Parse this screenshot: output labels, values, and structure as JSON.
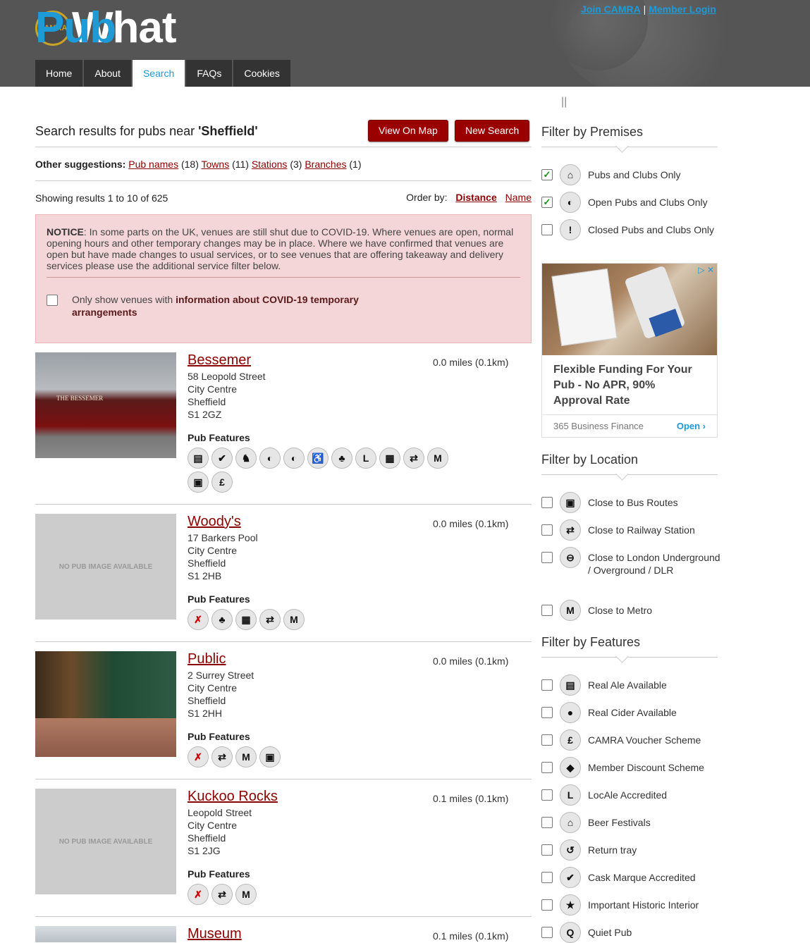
{
  "header": {
    "logo_seal": "CAMRA",
    "logo_what": "What",
    "logo_pub": "Pub",
    "join": "Join CAMRA",
    "sep": "|",
    "login": "Member Login"
  },
  "nav": [
    {
      "label": "Home"
    },
    {
      "label": "About"
    },
    {
      "label": "Search"
    },
    {
      "label": "FAQs"
    },
    {
      "label": "Cookies"
    }
  ],
  "pipes": "||",
  "search": {
    "prefix": "Search results for pubs near ",
    "term": "'Sheffield'",
    "view_map": "View On Map",
    "new_search": "New Search"
  },
  "suggestions": {
    "label": "Other suggestions:",
    "items": [
      {
        "link": "Pub names",
        "count": "(18)"
      },
      {
        "link": "Towns",
        "count": "(11)"
      },
      {
        "link": "Stations",
        "count": "(3)"
      },
      {
        "link": "Branches",
        "count": "(1)"
      }
    ]
  },
  "results": {
    "showing": "Showing results 1 to 10 of 625",
    "order_label": "Order by:",
    "order_distance": "Distance",
    "order_name": "Name"
  },
  "notice": {
    "label": "NOTICE",
    "text": ": In some parts on the UK, venues are still shut due to COVID-19. Where venues are open, normal opening hours and other temporary changes may be in place. Where we have confirmed that venues are open but have made changes to usual services, or to see venues that are offering takeaway and delivery services please use the additional service filter below.",
    "check_prefix": "Only show venues with ",
    "check_bold": "information about COVID-19 temporary arrangements"
  },
  "features_label": "Pub Features",
  "no_image": "NO PUB IMAGE AVAILABLE",
  "pubs": [
    {
      "name": "Bessemer",
      "street": "58 Leopold Street",
      "area": "City Centre",
      "town": "Sheffield",
      "postcode": "S1 2GZ",
      "distance": "0.0 miles (0.1km)",
      "photo_sign": "THE BESSEMER"
    },
    {
      "name": "Woody's",
      "street": "17 Barkers Pool",
      "area": "City Centre",
      "town": "Sheffield",
      "postcode": "S1 2HB",
      "distance": "0.0 miles (0.1km)"
    },
    {
      "name": "Public",
      "street": "2 Surrey Street",
      "area": "City Centre",
      "town": "Sheffield",
      "postcode": "S1 2HH",
      "distance": "0.0 miles (0.1km)"
    },
    {
      "name": "Kuckoo Rocks",
      "street": "Leopold Street",
      "area": "City Centre",
      "town": "Sheffield",
      "postcode": "S1 2JG",
      "distance": "0.1 miles (0.1km)"
    },
    {
      "name": "Museum",
      "distance": "0.1 miles (0.1km)"
    }
  ],
  "icons": {
    "cask": "▤",
    "tick": "✔",
    "horse": "♞",
    "half": "◐",
    "wheelchair": "♿",
    "club": "♣",
    "L": "L",
    "calendar": "▦",
    "rail": "⇄",
    "M": "M",
    "bus": "▣",
    "pound": "£",
    "nope": "✗",
    "tube": "⊖",
    "apple": "●",
    "tag": "◆",
    "tent": "⌂",
    "return": "↺",
    "star": "★",
    "Q": "Q",
    "building": "⌂",
    "excl": "!"
  },
  "sidebar": {
    "premises_title": "Filter by Premises",
    "premises": [
      {
        "label": "Pubs and Clubs Only",
        "check": "✓"
      },
      {
        "label": "Open Pubs and Clubs Only",
        "check": "✓"
      },
      {
        "label": "Closed Pubs and Clubs Only",
        "check": ""
      }
    ],
    "location_title": "Filter by Location",
    "location": [
      {
        "label": "Close to Bus Routes"
      },
      {
        "label": "Close to Railway Station"
      },
      {
        "label": "Close to London Underground / Overground / DLR"
      },
      {
        "label": "Close to Metro"
      }
    ],
    "features_title": "Filter by Features",
    "features": [
      {
        "label": "Real Ale Available"
      },
      {
        "label": "Real Cider Available"
      },
      {
        "label": "CAMRA Voucher Scheme"
      },
      {
        "label": "Member Discount Scheme"
      },
      {
        "label": "LocAle Accredited"
      },
      {
        "label": "Beer Festivals"
      },
      {
        "label": "Return tray"
      },
      {
        "label": "Cask Marque Accredited"
      },
      {
        "label": "Important Historic Interior"
      },
      {
        "label": "Quiet Pub"
      }
    ]
  },
  "ad": {
    "controls": "▷ ✕",
    "headline": "Flexible Funding For Your Pub - No APR, 90% Approval Rate",
    "advertiser": "365 Business Finance",
    "cta": "Open ›"
  }
}
